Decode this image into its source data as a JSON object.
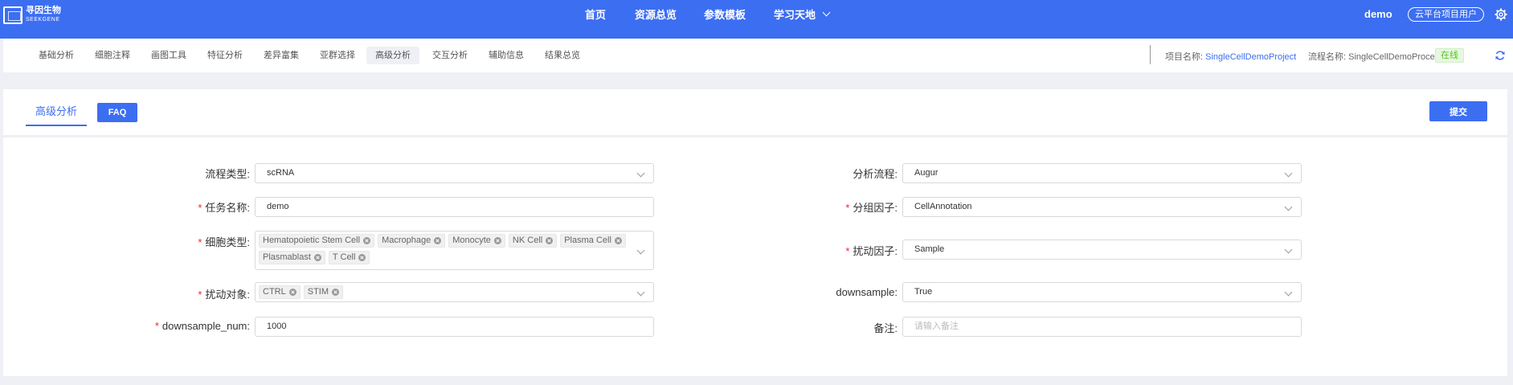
{
  "brand": {
    "name_cn": "寻因生物",
    "name_en": "SEEKGENE"
  },
  "topnav": [
    {
      "label": "首页"
    },
    {
      "label": "资源总览"
    },
    {
      "label": "参数模板"
    },
    {
      "label": "学习天地"
    }
  ],
  "user": {
    "name": "demo",
    "role": "云平台项目用户"
  },
  "subnav": [
    {
      "label": "基础分析"
    },
    {
      "label": "细胞注释"
    },
    {
      "label": "画图工具"
    },
    {
      "label": "特征分析"
    },
    {
      "label": "差异富集"
    },
    {
      "label": "亚群选择"
    },
    {
      "label": "高级分析",
      "active": true
    },
    {
      "label": "交互分析"
    },
    {
      "label": "辅助信息"
    },
    {
      "label": "结果总览"
    }
  ],
  "project": {
    "project_label": "项目名称:",
    "project_value": "SingleCellDemoProject",
    "process_label": "流程名称:",
    "process_value": "SingleCellDemoProcess",
    "status": "在线"
  },
  "panel": {
    "tab_label": "高级分析",
    "faq_label": "FAQ",
    "submit_label": "提交"
  },
  "form": {
    "pipeline_type": {
      "label": "流程类型:",
      "value": "scRNA"
    },
    "task_name": {
      "label": "任务名称:",
      "value": "demo"
    },
    "cell_type": {
      "label": "细胞类型:",
      "tags": [
        "Hematopoietic Stem Cell",
        "Macrophage",
        "Monocyte",
        "NK Cell",
        "Plasma Cell",
        "Plasmablast",
        "T Cell"
      ]
    },
    "perturb_object": {
      "label": "扰动对象:",
      "tags": [
        "CTRL",
        "STIM"
      ]
    },
    "downsample_num": {
      "label": "downsample_num:",
      "value": "1000"
    },
    "analysis_pipeline": {
      "label": "分析流程:",
      "value": "Augur"
    },
    "group_factor": {
      "label": "分组因子:",
      "value": "CellAnnotation"
    },
    "perturb_factor": {
      "label": "扰动因子:",
      "value": "Sample"
    },
    "downsample": {
      "label": "downsample:",
      "value": "True"
    },
    "remark": {
      "label": "备注:",
      "placeholder": "请输入备注"
    }
  },
  "colors": {
    "primary": "#3c6ef2",
    "required": "#f5222d",
    "online": "#52c41a"
  }
}
